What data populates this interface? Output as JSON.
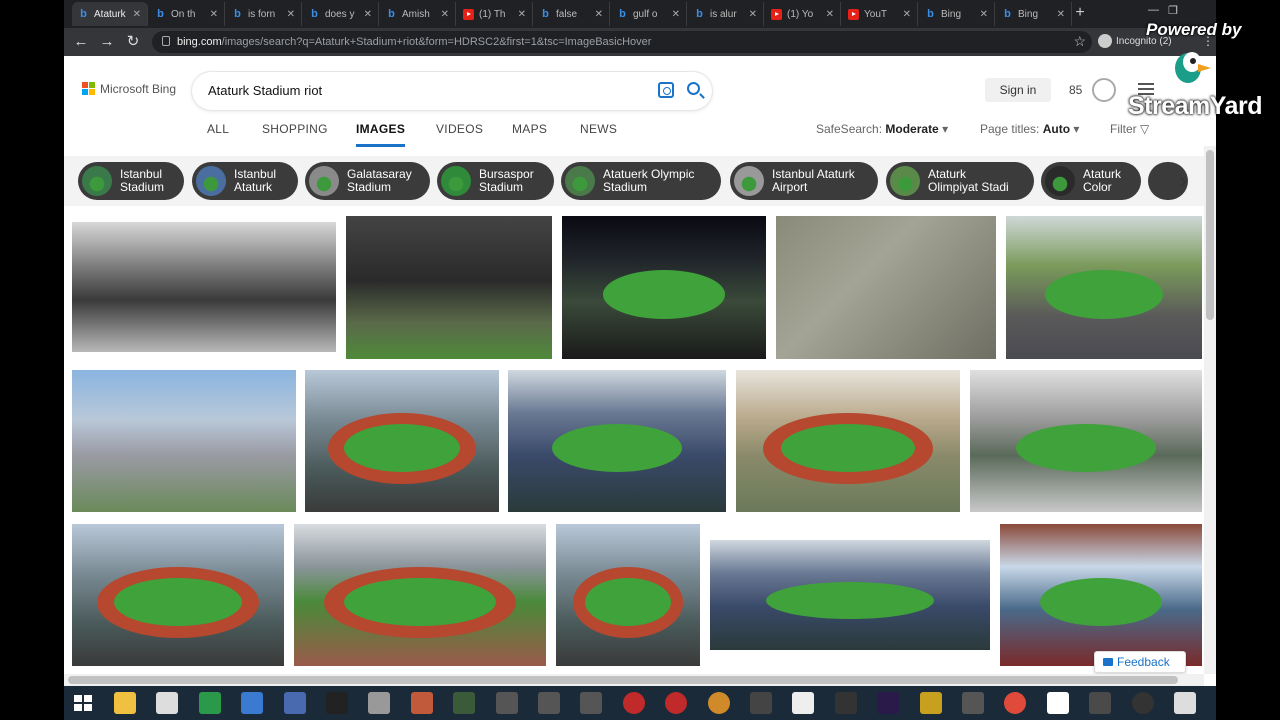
{
  "browser": {
    "tabs": [
      {
        "label": "Ataturk",
        "type": "bing",
        "active": true
      },
      {
        "label": "On th",
        "type": "bing"
      },
      {
        "label": "is forn",
        "type": "bing"
      },
      {
        "label": "does y",
        "type": "bing"
      },
      {
        "label": "Amish",
        "type": "bing"
      },
      {
        "label": "(1) Th",
        "type": "youtube"
      },
      {
        "label": "false",
        "type": "bing"
      },
      {
        "label": "gulf o",
        "type": "bing"
      },
      {
        "label": "is alur",
        "type": "bing"
      },
      {
        "label": "(1) Yo",
        "type": "youtube"
      },
      {
        "label": "YouT",
        "type": "youtube"
      },
      {
        "label": "Bing",
        "type": "bing"
      },
      {
        "label": "Bing",
        "type": "bing"
      }
    ],
    "new_tab_glyph": "+",
    "url_host": "bing.com",
    "url_rest": "/images/search?q=Ataturk+Stadium+riot&form=HDRSC2&first=1&tsc=ImageBasicHover",
    "incognito_label": "Incognito (2)"
  },
  "bing": {
    "logo_text": "Microsoft Bing",
    "query": "Ataturk Stadium riot",
    "signin_label": "Sign in",
    "rewards_points": "85",
    "scopes": [
      "ALL",
      "SHOPPING",
      "IMAGES",
      "VIDEOS",
      "MAPS",
      "NEWS"
    ],
    "active_scope": "IMAGES",
    "safesearch_label": "SafeSearch:",
    "safesearch_value": "Moderate",
    "pagetitles_label": "Page titles:",
    "pagetitles_value": "Auto",
    "filter_label": "Filter",
    "related_chips": [
      {
        "line1": "Istanbul",
        "line2": "Stadium"
      },
      {
        "line1": "Istanbul",
        "line2": "Ataturk"
      },
      {
        "line1": "Galatasaray",
        "line2": "Stadium"
      },
      {
        "line1": "Bursaspor",
        "line2": "Stadium"
      },
      {
        "line1": "Atatuerk Olympic",
        "line2": "Stadium"
      },
      {
        "line1": "Istanbul Ataturk",
        "line2": "Airport"
      },
      {
        "line1": "Ataturk",
        "line2": "Olimpiyat Stadi"
      },
      {
        "line1": "Ataturk",
        "line2": "Color"
      }
    ],
    "feedback_label": "Feedback"
  },
  "overlay": {
    "powered_by": "Powered by",
    "brand": "StreamYard"
  },
  "colors": {
    "accent": "#1a73c8",
    "chip_bg": "#3b3b3b",
    "taskbar": "#1b2a38"
  }
}
